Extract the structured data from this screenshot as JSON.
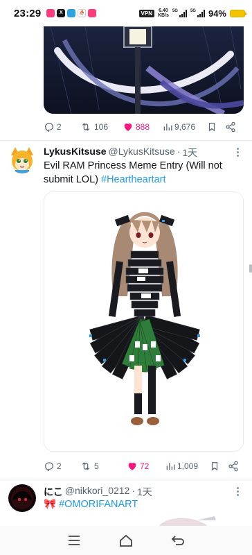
{
  "status_bar": {
    "time": "23:29",
    "vpn_label": "VPN",
    "speed_value": "6.40",
    "speed_unit": "KB/s",
    "network_1": "5G",
    "network_2": "5G",
    "battery_percent": "94%",
    "battery_level": 0.94
  },
  "tweet_1": {
    "replies": "2",
    "retweets": "106",
    "likes": "888",
    "views": "9,676"
  },
  "tweet_2": {
    "display_name": "LykusKitsuse",
    "handle": "@LykusKitsuse",
    "separator": "·",
    "time": "1天",
    "text": "Evil RAM Princess Meme Entry (Will not submit LOL) ",
    "hashtag": "#Heartheartart",
    "replies": "2",
    "retweets": "5",
    "likes": "72",
    "views": "1,009"
  },
  "tweet_3": {
    "display_name": "にこ",
    "handle": "@nikkori_0212",
    "separator": "·",
    "time": "1天",
    "emoji": "🎀",
    "hashtag": "#OMORIFANART"
  },
  "colors": {
    "like_pink": "#f91880",
    "hashtag_blue": "#1d9bf0",
    "muted": "#536471"
  },
  "icons": [
    "reply-icon",
    "retweet-icon",
    "like-icon",
    "views-icon",
    "bookmark-icon",
    "share-icon",
    "more-icon",
    "menu-icon",
    "home-icon",
    "back-icon"
  ]
}
